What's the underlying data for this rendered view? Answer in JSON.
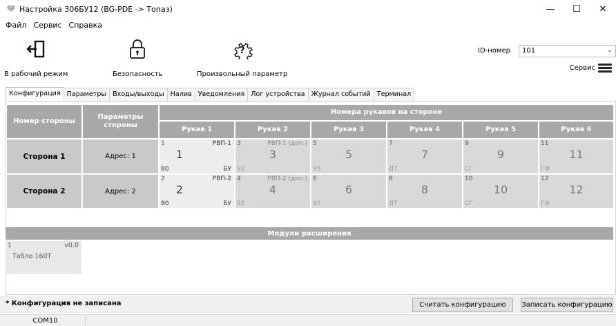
{
  "window": {
    "title": "Настройка 306БУ12 (BG-PDE -> Топаз)",
    "minimize": "—",
    "maximize": "☐",
    "close": "✕"
  },
  "menu": [
    "Файл",
    "Сервис",
    "Справка"
  ],
  "toolbar": {
    "work_mode": "В рабочий режим",
    "security": "Безопасность",
    "custom_param": "Произвольный параметр",
    "id_label": "ID-номер",
    "id_value": "101",
    "service": "Сервис"
  },
  "tabs": [
    "Конфигурация",
    "Параметры",
    "Входы/выходы",
    "Налив",
    "Уведомления",
    "Лог устройства",
    "Журнал событий",
    "Терминал"
  ],
  "active_tab": 0,
  "table": {
    "col_side": "Номер стороны",
    "col_params": "Параметры стороны",
    "hoses_header": "Номера рукавов на стороне",
    "hose_cols": [
      "Рукав 1",
      "Рукав 2",
      "Рукав 3",
      "Рукав 4",
      "Рукав 5",
      "Рукав 6"
    ],
    "rows": [
      {
        "side": "Сторона 1",
        "addr": "Адрес: 1",
        "hoses": [
          {
            "n": "1",
            "big": "1",
            "pr": "РВП-1",
            "fuel": "80",
            "unit": "БУ"
          },
          {
            "n": "3",
            "big": "3",
            "pr": "РВП-1 (доп.)",
            "fuel": "92",
            "unit": ""
          },
          {
            "n": "5",
            "big": "5",
            "pr": "",
            "fuel": "95",
            "unit": ""
          },
          {
            "n": "7",
            "big": "7",
            "pr": "",
            "fuel": "ДТ",
            "unit": ""
          },
          {
            "n": "9",
            "big": "9",
            "pr": "",
            "fuel": "СГ",
            "unit": ""
          },
          {
            "n": "11",
            "big": "11",
            "pr": "",
            "fuel": "ГФ",
            "unit": ""
          }
        ]
      },
      {
        "side": "Сторона 2",
        "addr": "Адрес: 2",
        "hoses": [
          {
            "n": "2",
            "big": "2",
            "pr": "РВП-2",
            "fuel": "80",
            "unit": "БУ"
          },
          {
            "n": "4",
            "big": "4",
            "pr": "РВП-2 (доп.)",
            "fuel": "92",
            "unit": ""
          },
          {
            "n": "6",
            "big": "6",
            "pr": "",
            "fuel": "95",
            "unit": ""
          },
          {
            "n": "8",
            "big": "8",
            "pr": "",
            "fuel": "ДТ",
            "unit": ""
          },
          {
            "n": "10",
            "big": "10",
            "pr": "",
            "fuel": "СГ",
            "unit": ""
          },
          {
            "n": "12",
            "big": "12",
            "pr": "",
            "fuel": "ГФ",
            "unit": ""
          }
        ]
      }
    ]
  },
  "modules": {
    "header": "Модули расширения",
    "items": [
      {
        "n": "1",
        "version": "v0.0",
        "name": "Табло 160Т"
      }
    ]
  },
  "footer": {
    "warning": "* Конфигурация не записана",
    "read_btn": "Считать конфигурацию",
    "write_btn": "Записать конфигурацию",
    "port": "COM10"
  }
}
